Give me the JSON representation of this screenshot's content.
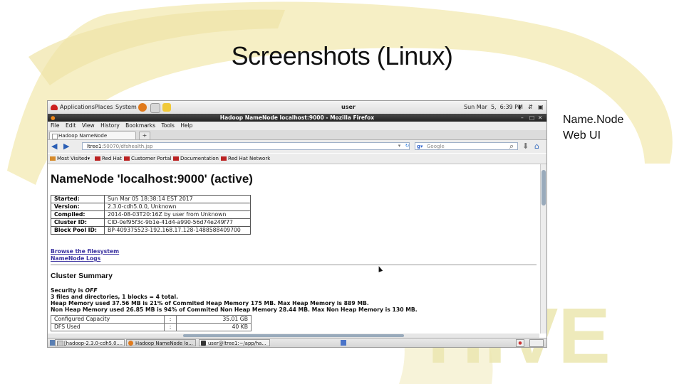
{
  "slide": {
    "title": "Screenshots (Linux)",
    "side_note_line1": "Name.Node",
    "side_note_line2": "Web UI",
    "watermark": "HIVE"
  },
  "gnome_panel": {
    "applications": "Applications",
    "places": "Places",
    "system": "System",
    "user": "user",
    "clock": "Sun Mar  5,  6:39 PM"
  },
  "window": {
    "title": "Hadoop NameNode localhost:9000 - Mozilla Firefox"
  },
  "menu": [
    "File",
    "Edit",
    "View",
    "History",
    "Bookmarks",
    "Tools",
    "Help"
  ],
  "tab": {
    "label": "Hadoop NameNode localhost:9...",
    "new_tab": "+"
  },
  "nav": {
    "url_host": "ltree1",
    "url_path": ":50070/dfshealth.jsp",
    "search_placeholder": "Google"
  },
  "bookmarks": [
    "Most Visited▾",
    "Red Hat",
    "Customer Portal",
    "Documentation",
    "Red Hat Network"
  ],
  "page": {
    "heading": "NameNode 'localhost:9000' (active)",
    "info_rows": [
      {
        "label": "Started:",
        "value": "Sun Mar 05 18:38:14 EST 2017"
      },
      {
        "label": "Version:",
        "value": "2.3.0-cdh5.0.0, Unknown"
      },
      {
        "label": "Compiled:",
        "value": "2014-08-03T20:16Z by user from Unknown"
      },
      {
        "label": "Cluster ID:",
        "value": "CID-0ef95f3c-9b1e-41d4-a990-56d74e249f77"
      },
      {
        "label": "Block Pool ID:",
        "value": "BP-409375523-192.168.17.128-1488588409700"
      }
    ],
    "link_browse": "Browse the filesystem",
    "link_logs": "NameNode Logs",
    "cluster_summary": "Cluster Summary",
    "security_prefix": "Security is ",
    "security_value": "OFF",
    "files_line": "3 files and directories, 1 blocks = 4 total.",
    "heap_line": "Heap Memory used 37.56 MB is 21% of Commited Heap Memory 175 MB. Max Heap Memory is 889 MB.",
    "nonheap_line": "Non Heap Memory used 26.85 MB is 94% of Commited Non Heap Memory 28.44 MB. Max Non Heap Memory is 130 MB.",
    "capacity_rows": [
      {
        "label": "Configured Capacity",
        "sep": ":",
        "value": "35.01 GB"
      },
      {
        "label": "DFS Used",
        "sep": ":",
        "value": "40 KB"
      }
    ]
  },
  "taskbar": [
    "[hadoop-2.3.0-cdh5.0....",
    "Hadoop NameNode lo...",
    "user@ltree1:~/app/ha..."
  ],
  "colors": {
    "link": "#3a31a0",
    "swoosh": "#f3eab2",
    "watermark": "#ece6a6"
  }
}
